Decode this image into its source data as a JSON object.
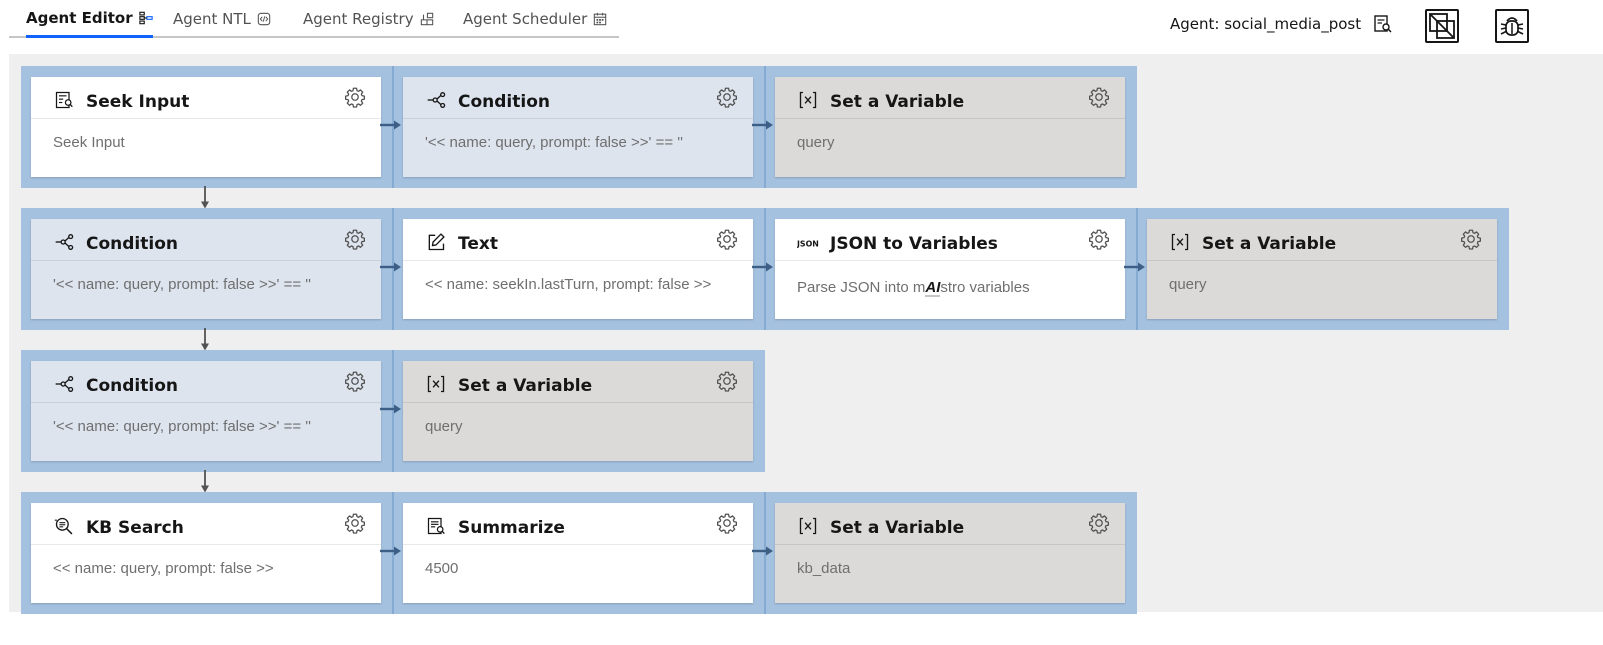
{
  "tabs": [
    {
      "label": "Agent Editor",
      "icon": "flow-icon",
      "active": true
    },
    {
      "label": "Agent NTL",
      "icon": "code-icon",
      "active": false
    },
    {
      "label": "Agent Registry",
      "icon": "registry-icon",
      "active": false
    },
    {
      "label": "Agent Scheduler",
      "icon": "scheduler-icon",
      "active": false
    }
  ],
  "agent": {
    "label": "Agent: social_media_post",
    "icon": "document-search-icon"
  },
  "toolbar": [
    {
      "icon": "layers-icon"
    },
    {
      "icon": "debug-icon"
    }
  ],
  "colors": {
    "accent": "#0f62fe",
    "strip": "#a4c1df",
    "canvas": "#efefef",
    "node_white": "#ffffff",
    "node_blue": "#dde4ee",
    "node_gray": "#dcdad8"
  },
  "rows": [
    {
      "nodes": [
        {
          "icon": "seek-input-icon",
          "title": "Seek Input",
          "body": "Seek Input",
          "style": "white"
        },
        {
          "icon": "condition-icon",
          "title": "Condition",
          "body": "'<< name: query, prompt: false >>' == ''",
          "style": "blue"
        },
        {
          "icon": "variable-icon",
          "title": "Set a Variable",
          "body": "query",
          "style": "gray"
        }
      ]
    },
    {
      "nodes": [
        {
          "icon": "condition-icon",
          "title": "Condition",
          "body": "'<< name: query, prompt: false >>' == ''",
          "style": "blue"
        },
        {
          "icon": "edit-icon",
          "title": "Text",
          "body": "<< name: seekIn.lastTurn, prompt: false >>",
          "style": "white"
        },
        {
          "icon": "json-icon",
          "title": "JSON to Variables",
          "body_pre": "Parse JSON into m",
          "body_brand": "AI",
          "body_post": "stro variables",
          "style": "white"
        },
        {
          "icon": "variable-icon",
          "title": "Set a Variable",
          "body": "query",
          "style": "gray"
        }
      ]
    },
    {
      "nodes": [
        {
          "icon": "condition-icon",
          "title": "Condition",
          "body": "'<< name: query, prompt: false >>' == ''",
          "style": "blue"
        },
        {
          "icon": "variable-icon",
          "title": "Set a Variable",
          "body": "query",
          "style": "gray"
        }
      ]
    },
    {
      "nodes": [
        {
          "icon": "kb-search-icon",
          "title": "KB Search",
          "body": "<< name: query, prompt: false >>",
          "style": "white"
        },
        {
          "icon": "summarize-icon",
          "title": "Summarize",
          "body": "4500",
          "style": "white"
        },
        {
          "icon": "variable-icon",
          "title": "Set a Variable",
          "body": "kb_data",
          "style": "gray"
        }
      ]
    }
  ]
}
